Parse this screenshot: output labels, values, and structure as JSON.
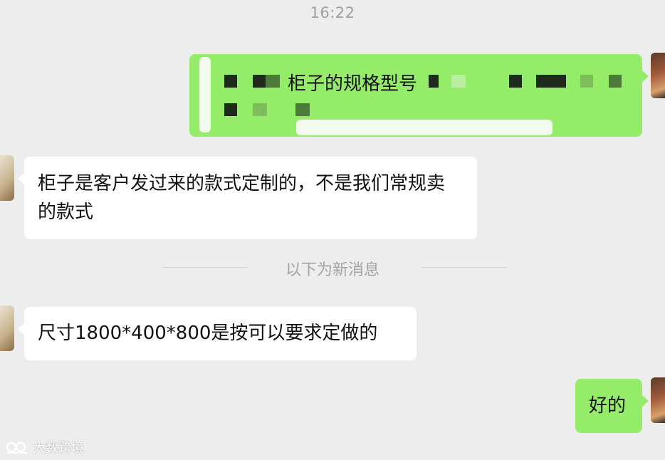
{
  "chat": {
    "timestamp": "16:22",
    "messages": [
      {
        "id": "m1",
        "direction": "outgoing",
        "visible_text": "柜子的规格型号",
        "redacted": true
      },
      {
        "id": "m2",
        "direction": "incoming",
        "text": "柜子是客户发过来的款式定制的，不是我们常规卖的款式"
      },
      {
        "id": "m3",
        "direction": "incoming",
        "text": "尺寸1800*400*800是按可以要求定做的"
      },
      {
        "id": "m4",
        "direction": "outgoing",
        "text": "好的"
      }
    ],
    "divider": {
      "label": "以下为新消息"
    }
  },
  "watermark": {
    "text": "大数跨境"
  },
  "colors": {
    "background": "#ededed",
    "outgoing_bubble": "#95ec69",
    "incoming_bubble": "#ffffff",
    "meta_text": "#9e9e9e"
  }
}
